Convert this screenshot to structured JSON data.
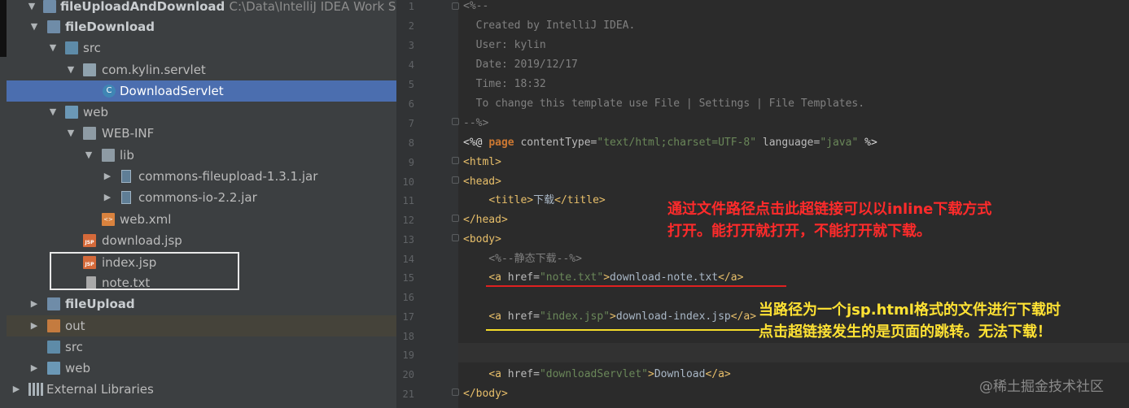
{
  "tree": {
    "items": [
      {
        "label": "fileUploadAndDownload",
        "path": "C:\\Data\\IntelliJ IDEA Work Space\\"
      },
      {
        "label": "fileDownload"
      },
      {
        "label": "src"
      },
      {
        "label": "com.kylin.servlet"
      },
      {
        "label": "DownloadServlet"
      },
      {
        "label": "web"
      },
      {
        "label": "WEB-INF"
      },
      {
        "label": "lib"
      },
      {
        "label": "commons-fileupload-1.3.1.jar"
      },
      {
        "label": "commons-io-2.2.jar"
      },
      {
        "label": "web.xml"
      },
      {
        "label": "download.jsp"
      },
      {
        "label": "index.jsp"
      },
      {
        "label": "note.txt"
      },
      {
        "label": "fileUpload"
      },
      {
        "label": "out"
      },
      {
        "label": "src"
      },
      {
        "label": "web"
      },
      {
        "label": "External Libraries"
      }
    ],
    "icons": {
      "class": "C",
      "jsp": "JSP",
      "xml": "<>"
    }
  },
  "editor": {
    "line_numbers": [
      "1",
      "2",
      "3",
      "4",
      "5",
      "6",
      "7",
      "8",
      "9",
      "10",
      "11",
      "12",
      "13",
      "14",
      "15",
      "16",
      "17",
      "18",
      "19",
      "20",
      "21"
    ],
    "lines": [
      [
        "<%--"
      ],
      [
        "  Created by IntelliJ IDEA."
      ],
      [
        "  User: kylin"
      ],
      [
        "  Date: 2019/12/17"
      ],
      [
        "  Time: 18:32"
      ],
      [
        "  To change this template use File | Settings | File Templates."
      ],
      [
        "--%>"
      ],
      [
        "<%@ ",
        "page",
        " contentType=",
        "\"text/html;charset=UTF-8\"",
        " language=",
        "\"java\"",
        " %>"
      ],
      [
        "<html>"
      ],
      [
        "<head>"
      ],
      [
        "    ",
        "<title>",
        "下载",
        "</title>"
      ],
      [
        "</head>"
      ],
      [
        "<body>"
      ],
      [
        "    <%--静态下载--%>"
      ],
      [
        "    ",
        "<a ",
        "href=",
        "\"note.txt\"",
        ">",
        "download-note.txt",
        "</a>"
      ],
      [
        ""
      ],
      [
        "    ",
        "<a ",
        "href=",
        "\"index.jsp\"",
        ">",
        "download-index.jsp",
        "</a>"
      ],
      [
        ""
      ],
      [
        ""
      ],
      [
        "    ",
        "<a ",
        "href=",
        "\"downloadServlet\"",
        ">",
        "Download",
        "</a>"
      ],
      [
        "</body>"
      ]
    ]
  },
  "annotations": {
    "red_line1": "通过文件路径点击此超链接可以以inline下载方式",
    "red_line2": "打开。能打开就打开，不能打开就下载。",
    "yellow_line1": "当路径为一个jsp.html格式的文件进行下载时",
    "yellow_line2": "点击超链接发生的是页面的跳转。无法下载！"
  },
  "watermark": "@稀土掘金技术社区",
  "colors": {
    "selection": "#4b6eaf",
    "annotation_red": "#ff2b2b",
    "annotation_yellow": "#ffe234"
  }
}
